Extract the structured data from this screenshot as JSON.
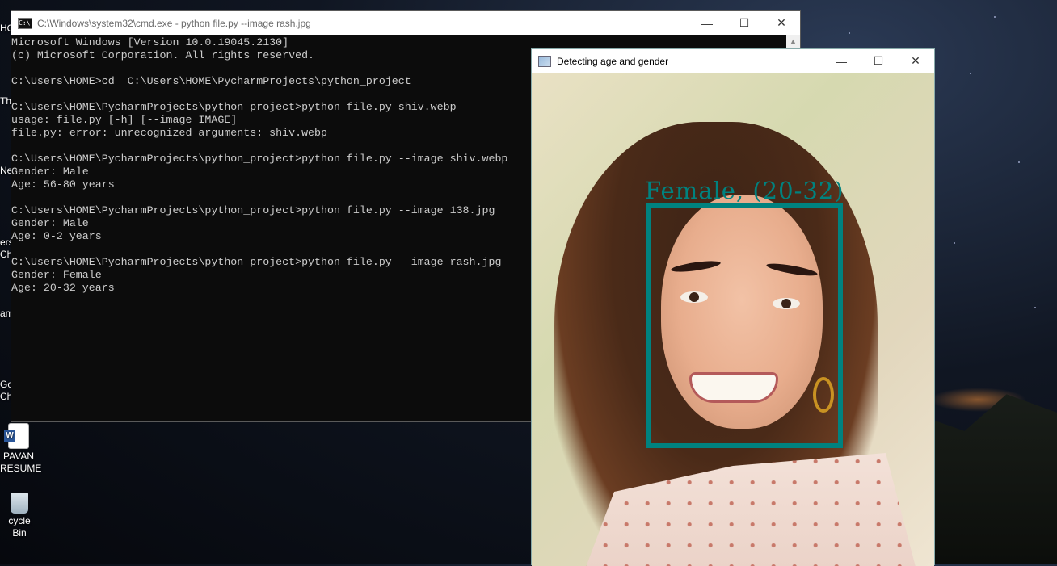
{
  "desktop": {
    "icons": [
      {
        "label": "HO",
        "name": "this-pc-partial"
      },
      {
        "label": "Thi",
        "name": "this-pc-icon"
      },
      {
        "label": "Net",
        "name": "network-icon"
      },
      {
        "label": "ers Chr",
        "name": "chrome-shortcut-partial"
      },
      {
        "label": "am",
        "name": "app-shortcut-partial"
      },
      {
        "label": "Go Chr",
        "name": "google-chrome-icon"
      },
      {
        "label": "PAVAN RESUME",
        "name": "word-document-icon"
      },
      {
        "label": "cycle Bin",
        "name": "recycle-bin-icon"
      }
    ]
  },
  "cmd": {
    "title": "C:\\Windows\\system32\\cmd.exe - python  file.py --image rash.jpg",
    "icon_label": "C:\\",
    "lines": [
      "Microsoft Windows [Version 10.0.19045.2130]",
      "(c) Microsoft Corporation. All rights reserved.",
      "",
      "C:\\Users\\HOME>cd  C:\\Users\\HOME\\PycharmProjects\\python_project",
      "",
      "C:\\Users\\HOME\\PycharmProjects\\python_project>python file.py shiv.webp",
      "usage: file.py [-h] [--image IMAGE]",
      "file.py: error: unrecognized arguments: shiv.webp",
      "",
      "C:\\Users\\HOME\\PycharmProjects\\python_project>python file.py --image shiv.webp",
      "Gender: Male",
      "Age: 56-80 years",
      "",
      "C:\\Users\\HOME\\PycharmProjects\\python_project>python file.py --image 138.jpg",
      "Gender: Male",
      "Age: 0-2 years",
      "",
      "C:\\Users\\HOME\\PycharmProjects\\python_project>python file.py --image rash.jpg",
      "Gender: Female",
      "Age: 20-32 years"
    ]
  },
  "image_window": {
    "title": "Detecting age and gender",
    "detection_label": "Female, (20-32)",
    "box_color": "#00827f"
  },
  "window_controls": {
    "minimize": "—",
    "maximize": "☐",
    "close": "✕"
  }
}
